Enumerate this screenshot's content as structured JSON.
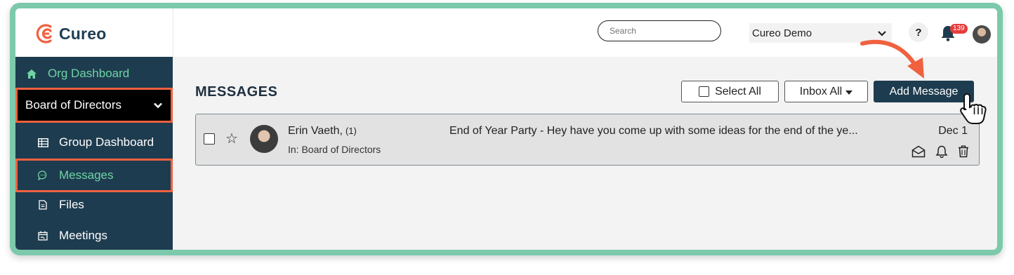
{
  "app": {
    "logo_text": "Cureo",
    "brand_color": "#f0613f",
    "sidebar_color": "#1e3c4f",
    "accent": "#6fd3a6"
  },
  "sidebar": {
    "org_dashboard": "Org Dashboard",
    "group_selector": "Board of Directors",
    "items": [
      {
        "label": "Group Dashboard",
        "icon": "table-icon"
      },
      {
        "label": "Messages",
        "icon": "chat-icon"
      },
      {
        "label": "Files",
        "icon": "file-icon"
      },
      {
        "label": "Meetings",
        "icon": "calendar-icon"
      }
    ]
  },
  "topbar": {
    "search_placeholder": "Search",
    "org_select": "Cureo Demo",
    "help_label": "?",
    "notification_count": "139"
  },
  "main": {
    "title": "MESSAGES",
    "select_all_label": "Select All",
    "inbox_filter_label": "Inbox All",
    "add_message_label": "Add Message"
  },
  "messages": [
    {
      "sender": "Erin Vaeth,",
      "count": "(1)",
      "group": "In: Board of Directors",
      "subject": "End of Year Party - Hey have you come up with some ideas for the end of the ye...",
      "date": "Dec 1"
    }
  ]
}
